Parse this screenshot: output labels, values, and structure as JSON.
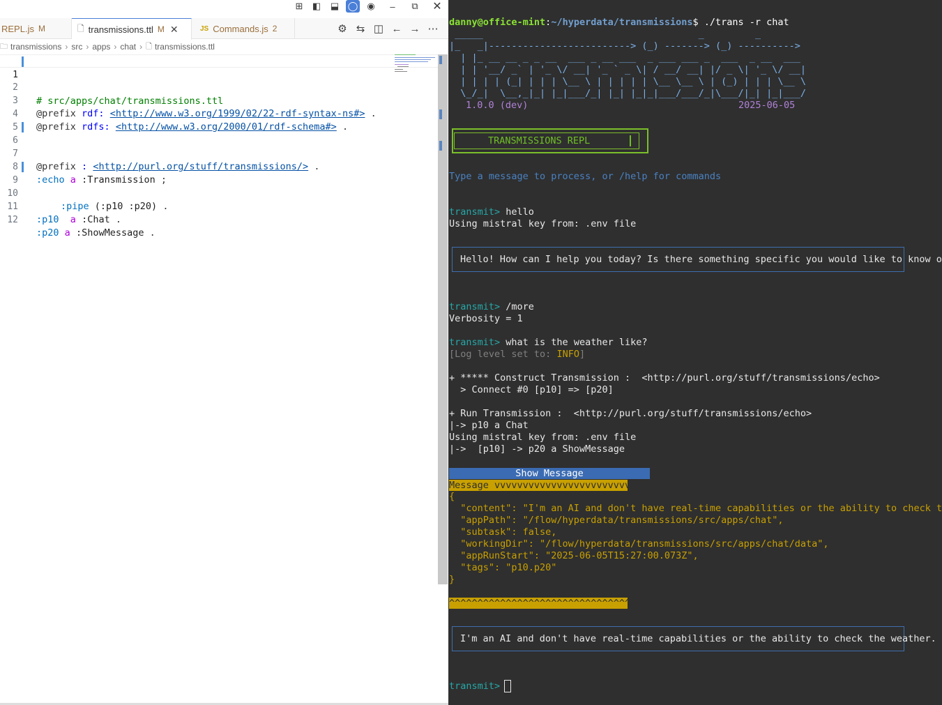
{
  "editor": {
    "tabs": [
      {
        "label": "REPL.js",
        "badge": "M",
        "icon": "js-icon"
      },
      {
        "label": "transmissions.ttl",
        "badge": "M",
        "icon": "file-icon",
        "active": true
      },
      {
        "label": "Commands.js",
        "badge": "2",
        "icon": "js-icon"
      }
    ],
    "js_glyph": "JS",
    "breadcrumb": [
      "transmissions",
      "src",
      "apps",
      "chat",
      "transmissions.ttl"
    ],
    "lines": [
      {
        "n": "1"
      },
      {
        "n": "2"
      },
      {
        "n": "3"
      },
      {
        "n": "4"
      },
      {
        "n": "5"
      },
      {
        "n": "6"
      },
      {
        "n": "7"
      },
      {
        "n": "8"
      },
      {
        "n": "9"
      },
      {
        "n": "10"
      },
      {
        "n": "11"
      },
      {
        "n": "12"
      }
    ],
    "code": {
      "l1_comment": "# src/apps/chat/transmissions.ttl",
      "kw_prefix": "@prefix",
      "p_rdf": "rdf:",
      "u_rdf": "<http://www.w3.org/1999/02/22-rdf-syntax-ns#>",
      "p_rdfs": "rdfs:",
      "u_rdfs": "<http://www.w3.org/2000/01/rdf-schema#>",
      "p_empty": ":",
      "u_empty": "<http://purl.org/stuff/transmissions/>",
      "dot": ".",
      "semi": ";",
      "a": "a",
      "echo": ":echo",
      "transmission": ":Transmission",
      "pipe": ":pipe",
      "pipe_list": "(:p10 :p20)",
      "p10": ":p10",
      "chat": ":Chat",
      "p20": ":p20",
      "showmessage": ":ShowMessage"
    }
  },
  "terminal": {
    "prompt_user": "danny@office-mint",
    "prompt_path": "~/hyperdata/transmissions",
    "prompt_cmd": "$ ./trans -r chat",
    "ascii": [
      " _____                                      _         _",
      "|_   _|-------------------------> (_) -------> (_) ---------->",
      "  | |_ __ __ _ _ __  ___ _ __ ___  _ ___ ___ _  ___  _ __  ___",
      "  | | '__/ _` | '_ \\/ __| '_ ` _ \\| / __/ __| |/ _ \\| '_ \\/ __|",
      "  | | | | (_| | | | \\__ \\ | | | | | \\__ \\__ \\ | (_) | | | \\__ \\",
      "  \\_/_|  \\__,_|_| |_|___/_| |_| |_|_|___/___/_|\\___/|_| |_|___/"
    ],
    "version": "1.0.0 (dev)",
    "date": "2025-06-05",
    "repl_title": "TRANSMISSIONS REPL",
    "hint": "Type a message to process, or /help for commands",
    "prompt": "transmit>",
    "cmd1": " hello",
    "key_line": "Using mistral key from: .env file",
    "resp1": "Hello! How can I help you today? Is there something specific you would like to know or",
    "cmd2": " /more",
    "verbosity": "Verbosity = 1",
    "cmd3": " what is the weather like?",
    "log_open": "[Log level set to: ",
    "log_level": "INFO",
    "log_close": "]",
    "construct": "+ ***** Construct Transmission :  <http://purl.org/stuff/transmissions/echo>",
    "connect": "  > Connect #0 [p10] => [p20]",
    "run": "+ Run Transmission :  <http://purl.org/stuff/transmissions/echo>",
    "p10chat": "|-> p10 a Chat",
    "key_line2": "Using mistral key from: .env file",
    "p20show": "|->  [p10] -> p20 a ShowMessage",
    "show_message": "Show Message",
    "message_bar": "Message vvvvvvvvvvvvvvvvvvvvvvvv",
    "json_lines": [
      "{",
      "  \"content\": \"I'm an AI and don't have real-time capabilities or the ability to check the",
      "  \"appPath\": \"/flow/hyperdata/transmissions/src/apps/chat\",",
      "  \"subtask\": false,",
      "  \"workingDir\": \"/flow/hyperdata/transmissions/src/apps/chat/data\",",
      "  \"appRunStart\": \"2025-06-05T15:27:00.073Z\",",
      "  \"tags\": \"p10.p20\"",
      "}"
    ],
    "caret_bar": "^^^^^^^^^^^^^^^^^^^^^^^^^^^^^^^^",
    "resp2": "I'm an AI and don't have real-time capabilities or the ability to check the weather. I",
    "final_prompt": "transmit>"
  },
  "colors": {
    "terminal_bg": "#2f2f2f",
    "accent": "#4a7fd8",
    "gold": "#c8a000"
  }
}
